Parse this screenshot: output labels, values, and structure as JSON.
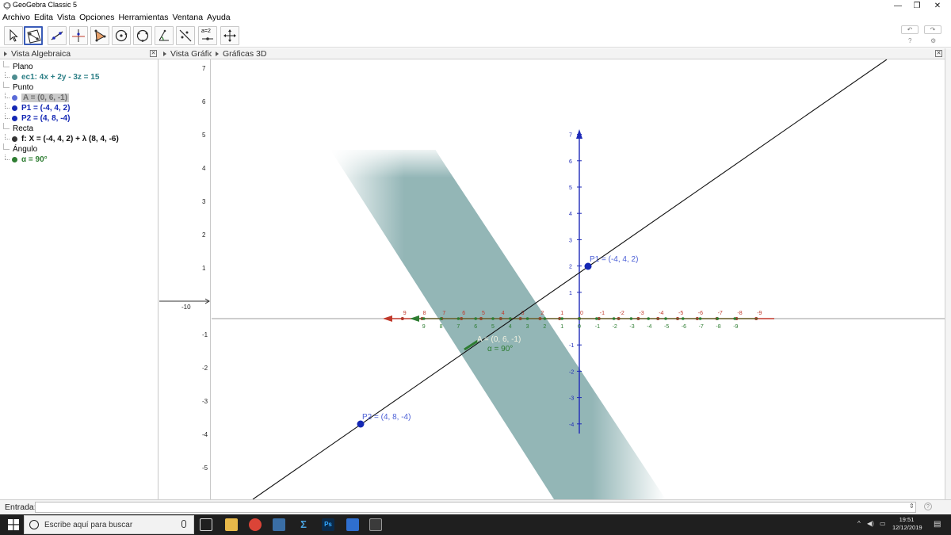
{
  "window": {
    "title": "GeoGebra Classic 5"
  },
  "menu": [
    "Archivo",
    "Edita",
    "Vista",
    "Opciones",
    "Herramientas",
    "Ventana",
    "Ayuda"
  ],
  "toolbar": {
    "tools": [
      "move-tool",
      "plane-tool",
      "line-tool",
      "perpendicular-tool",
      "polygon-tool",
      "circle-tool",
      "conic-tool",
      "angle-tool",
      "reflect-tool",
      "slider-tool",
      "move-view-tool"
    ],
    "slider_label": "a=2"
  },
  "panels": {
    "algebra_title": "Vista Algebraica",
    "graphics2d_title": "Vista Gráfic",
    "graphics3d_title": "Gráficas 3D"
  },
  "algebra": {
    "categories": [
      "Plano",
      "Punto",
      "Recta",
      "Ángulo"
    ],
    "plane": "ec1: 4x + 2y - 3z = 15",
    "point_a": "A = (0, 6, -1)",
    "point_p1": "P1 = (-4, 4, 2)",
    "point_p2": "P2 = (4, 8, -4)",
    "line_f": "f: X = (-4, 4, 2) + λ (8, 4, -6)",
    "angle": "α = 90°"
  },
  "graphics2d": {
    "y_ticks": [
      "7",
      "6",
      "5",
      "4",
      "3",
      "2",
      "1",
      "-1",
      "-2",
      "-3",
      "-4",
      "-5"
    ],
    "x_tick": "-10"
  },
  "graphics3d": {
    "label_p1": "P1 = (-4, 4, 2)",
    "label_p2": "P2 = (4, 8, -4)",
    "label_a": "A = (0, 6, -1)",
    "label_alpha": "α = 90°",
    "z_ticks": [
      "7",
      "6",
      "5",
      "4",
      "3",
      "2",
      "1",
      "-1",
      "-2",
      "-3",
      "-4"
    ],
    "x_red_ticks": [
      "9",
      "8",
      "7",
      "6",
      "5",
      "4",
      "3",
      "2",
      "1",
      "0",
      "-1",
      "-2",
      "-3",
      "-4",
      "-5",
      "-6",
      "-7",
      "-8",
      "-9"
    ],
    "y_green_ticks": [
      "9",
      "8",
      "7",
      "6",
      "5",
      "4",
      "3",
      "2",
      "1",
      "0",
      "-1",
      "-2",
      "-3",
      "-4",
      "-5",
      "-6",
      "-7",
      "-8",
      "-9"
    ],
    "colors": {
      "z_axis": "#1e2ab8",
      "x_axis": "#c0392b",
      "y_axis": "#2e7d32",
      "plane": "#6f9d9e",
      "point": "#1428b4"
    }
  },
  "input": {
    "label": "Entrada:"
  },
  "taskbar": {
    "search_placeholder": "Escribe aquí para buscar",
    "time": "19:51",
    "date": "12/12/2019"
  }
}
